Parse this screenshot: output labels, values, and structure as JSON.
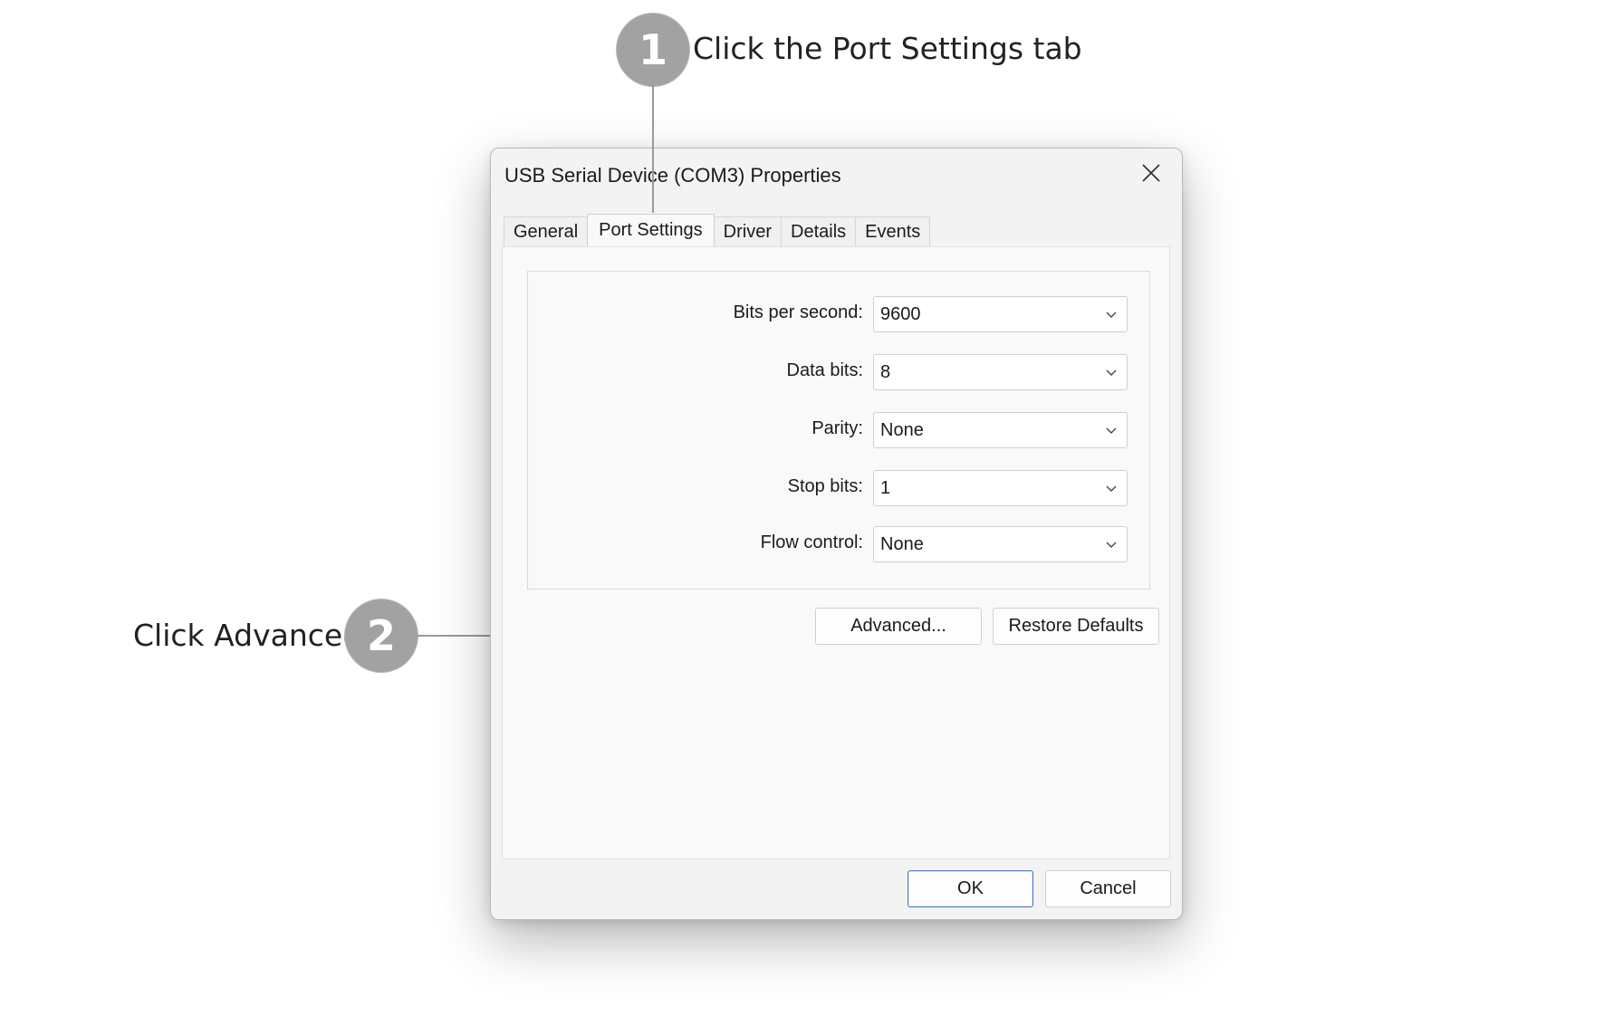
{
  "callouts": [
    {
      "number": "1",
      "text": "Click the Port Settings tab"
    },
    {
      "number": "2",
      "text": "Click Advanced"
    }
  ],
  "dialog": {
    "title": "USB Serial Device (COM3) Properties",
    "close_icon": "close-icon",
    "tabs": [
      {
        "label": "General",
        "active": false
      },
      {
        "label": "Port Settings",
        "active": true
      },
      {
        "label": "Driver",
        "active": false
      },
      {
        "label": "Details",
        "active": false
      },
      {
        "label": "Events",
        "active": false
      }
    ],
    "settings": [
      {
        "label": "Bits per second:",
        "value": "9600"
      },
      {
        "label": "Data bits:",
        "value": "8"
      },
      {
        "label": "Parity:",
        "value": "None"
      },
      {
        "label": "Stop bits:",
        "value": "1"
      },
      {
        "label": "Flow control:",
        "value": "None"
      }
    ],
    "buttons": {
      "advanced": "Advanced...",
      "restore_defaults": "Restore Defaults",
      "ok": "OK",
      "cancel": "Cancel"
    }
  },
  "colors": {
    "badge": "#a2a2a2",
    "dialog_bg": "#f3f3f3",
    "panel_bg": "#f9f9f9",
    "ok_border": "#4a78c5"
  }
}
